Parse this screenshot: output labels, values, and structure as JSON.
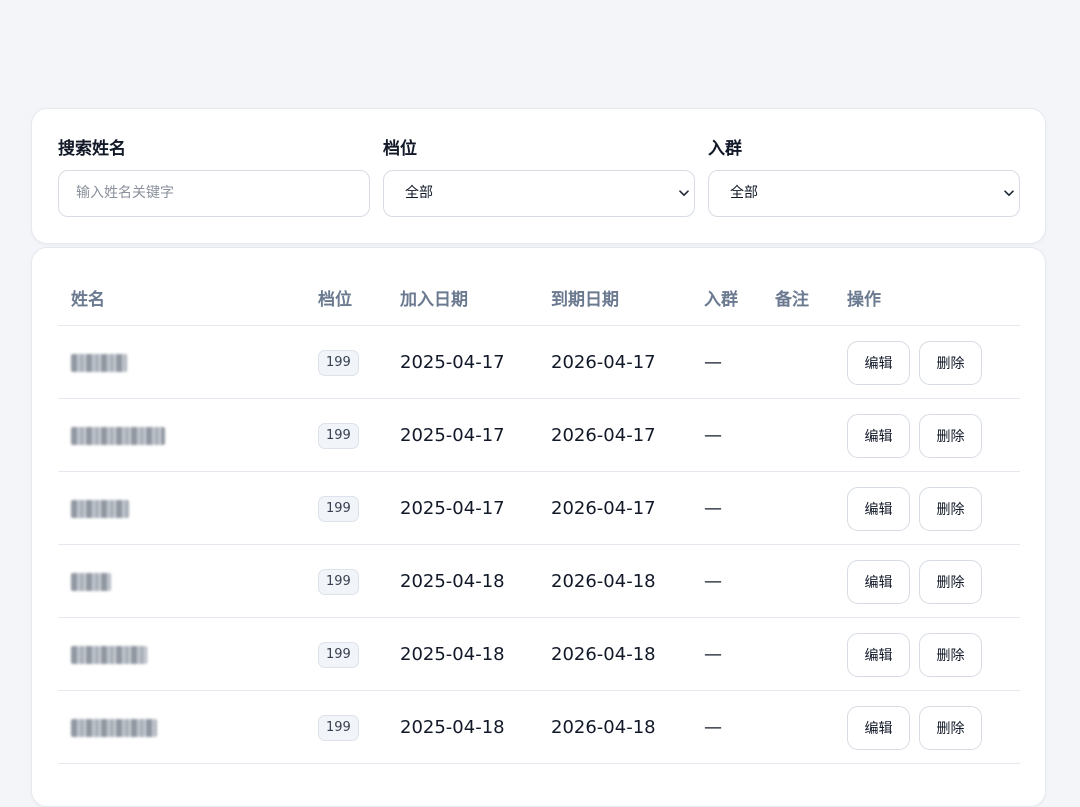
{
  "filters": {
    "search": {
      "label": "搜索姓名",
      "placeholder": "输入姓名关键字"
    },
    "tier": {
      "label": "档位",
      "value": "全部"
    },
    "group": {
      "label": "入群",
      "value": "全部"
    }
  },
  "table": {
    "headers": [
      "姓名",
      "档位",
      "加入日期",
      "到期日期",
      "入群",
      "备注",
      "操作"
    ],
    "rows": [
      {
        "tier": "199",
        "join": "2025-04-17",
        "expire": "2026-04-17",
        "group": "—",
        "note": "",
        "edit": "编辑",
        "delete": "删除"
      },
      {
        "tier": "199",
        "join": "2025-04-17",
        "expire": "2026-04-17",
        "group": "—",
        "note": "",
        "edit": "编辑",
        "delete": "删除"
      },
      {
        "tier": "199",
        "join": "2025-04-17",
        "expire": "2026-04-17",
        "group": "—",
        "note": "",
        "edit": "编辑",
        "delete": "删除"
      },
      {
        "tier": "199",
        "join": "2025-04-18",
        "expire": "2026-04-18",
        "group": "—",
        "note": "",
        "edit": "编辑",
        "delete": "删除"
      },
      {
        "tier": "199",
        "join": "2025-04-18",
        "expire": "2026-04-18",
        "group": "—",
        "note": "",
        "edit": "编辑",
        "delete": "删除"
      },
      {
        "tier": "199",
        "join": "2025-04-18",
        "expire": "2026-04-18",
        "group": "—",
        "note": "",
        "edit": "编辑",
        "delete": "删除"
      }
    ]
  },
  "icons": {
    "select_chevron": "chevron-down-icon"
  }
}
